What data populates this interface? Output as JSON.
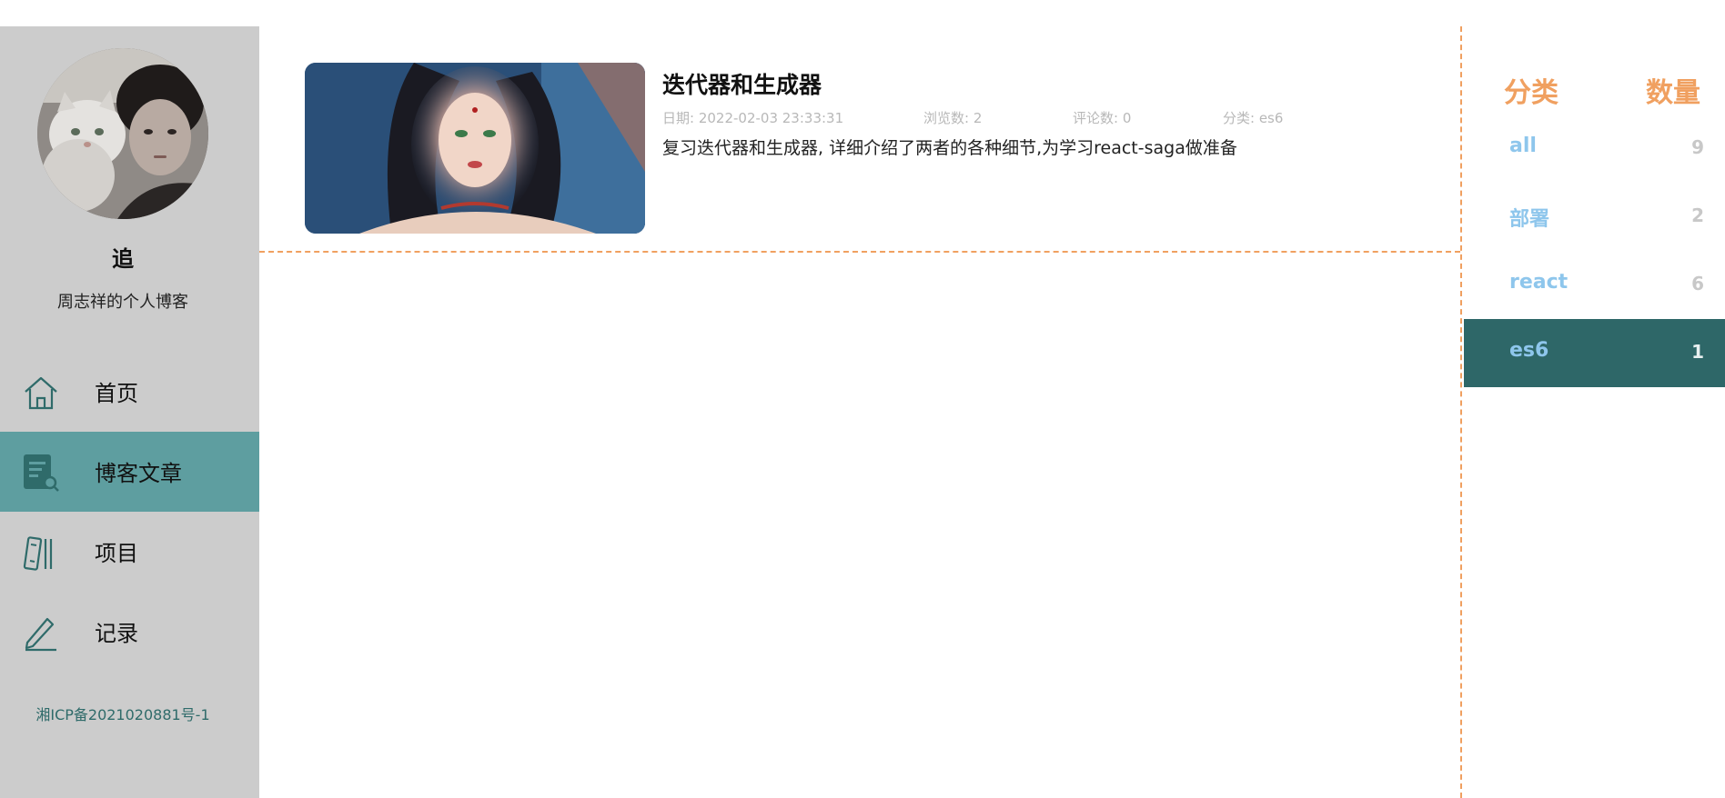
{
  "profile": {
    "name": "追",
    "subtitle": "周志祥的个人博客"
  },
  "nav": {
    "items": [
      {
        "label": "首页",
        "icon": "home-icon",
        "active": false
      },
      {
        "label": "博客文章",
        "icon": "article-search-icon",
        "active": true
      },
      {
        "label": "项目",
        "icon": "books-icon",
        "active": false
      },
      {
        "label": "记录",
        "icon": "pen-icon",
        "active": false
      }
    ]
  },
  "footer": {
    "icp": "湘ICP备2021020881号-1"
  },
  "articles": [
    {
      "title": "迭代器和生成器",
      "date": "日期: 2022-02-03 23:33:31",
      "views": "浏览数: 2",
      "comments": "评论数: 0",
      "category": "分类: es6",
      "description": "复习迭代器和生成器, 详细介绍了两者的各种细节,为学习react-saga做准备"
    }
  ],
  "categories": {
    "header_category": "分类",
    "header_count": "数量",
    "items": [
      {
        "name": "all",
        "count": "9",
        "active": false
      },
      {
        "name": "部署",
        "count": "2",
        "active": false
      },
      {
        "name": "react",
        "count": "6",
        "active": false
      },
      {
        "name": "es6",
        "count": "1",
        "active": true
      }
    ]
  },
  "colors": {
    "sidebar_bg": "#cccccc",
    "nav_active_bg": "#5e9ea0",
    "accent_orange": "#f0a060",
    "category_link": "#8ec6ec",
    "category_active_bg": "#2e6768"
  }
}
